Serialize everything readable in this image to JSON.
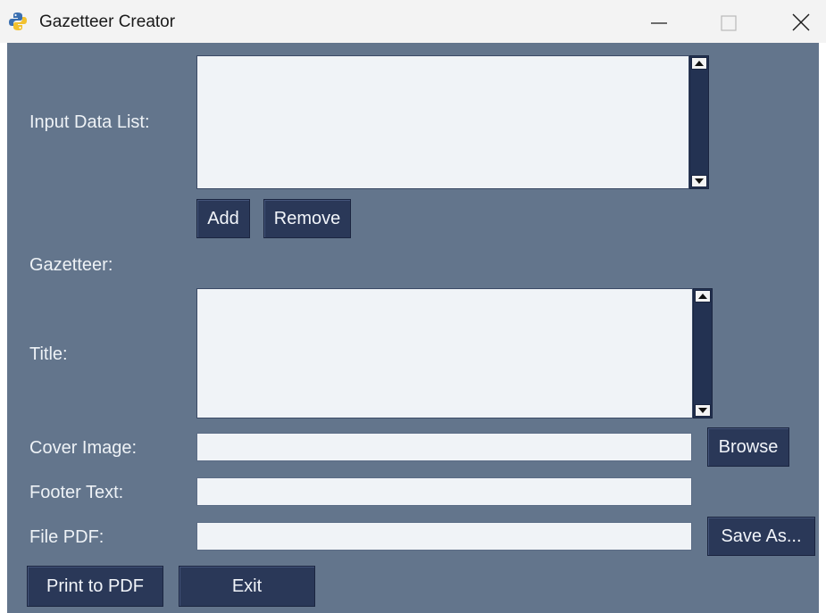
{
  "window": {
    "title": "Gazetteer Creator",
    "icon": "python-icon",
    "controls": [
      "minimize-icon",
      "maximize-icon",
      "close-icon"
    ]
  },
  "form": {
    "input_data_list_label": "Input Data List:",
    "add_button": "Add",
    "remove_button": "Remove",
    "gazetteer_label": "Gazetteer:",
    "title_label": "Title:",
    "cover_image_label": "Cover Image:",
    "cover_image_value": "",
    "browse_button": "Browse",
    "footer_text_label": "Footer Text:",
    "footer_text_value": "",
    "file_pdf_label": "File PDF:",
    "file_pdf_value": "",
    "save_as_button": "Save As...",
    "print_button": "Print to PDF",
    "exit_button": "Exit"
  },
  "colors": {
    "background": "#63758c",
    "button": "#2a3858",
    "field": "#f0f3f7",
    "titlebar": "#f3f3f3"
  }
}
